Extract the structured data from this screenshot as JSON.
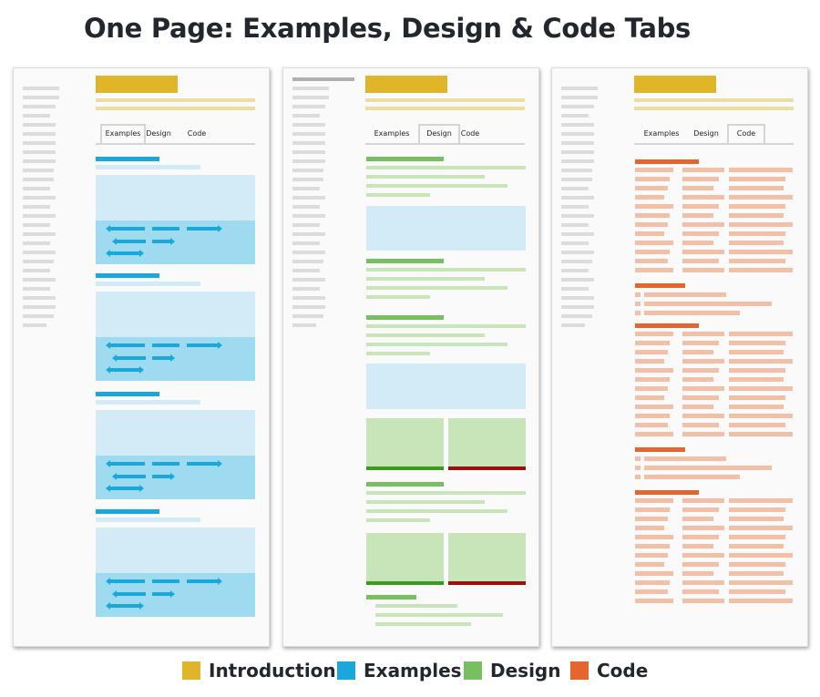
{
  "title": "One Page: Examples, Design & Code Tabs",
  "colors": {
    "introduction": "#e1b52a",
    "introduction_light": "#f0dc9f",
    "examples": "#1aa7da",
    "examples_light": "#d2ebf6",
    "examples_mid": "#9edaf0",
    "design": "#76c060",
    "design_light": "#c8e5b9",
    "design_dark_green": "#3a9b1f",
    "design_dark_red": "#9b0f0f",
    "code": "#e4662f",
    "code_light": "#f2c0a6",
    "sidebar": "#dcdcdc"
  },
  "panels": [
    {
      "id": "examples-panel",
      "tabs": [
        "Examples",
        "Design",
        "Code"
      ],
      "active_tab": "Examples"
    },
    {
      "id": "design-panel",
      "tabs": [
        "Examples",
        "Design",
        "Code"
      ],
      "active_tab": "Design"
    },
    {
      "id": "code-panel",
      "tabs": [
        "Examples",
        "Design",
        "Code"
      ],
      "active_tab": "Code"
    }
  ],
  "legend": [
    {
      "label": "Introduction",
      "color": "#e1b52a"
    },
    {
      "label": "Examples",
      "color": "#1aa7da"
    },
    {
      "label": "Design",
      "color": "#76c060"
    },
    {
      "label": "Code",
      "color": "#e4662f"
    }
  ]
}
